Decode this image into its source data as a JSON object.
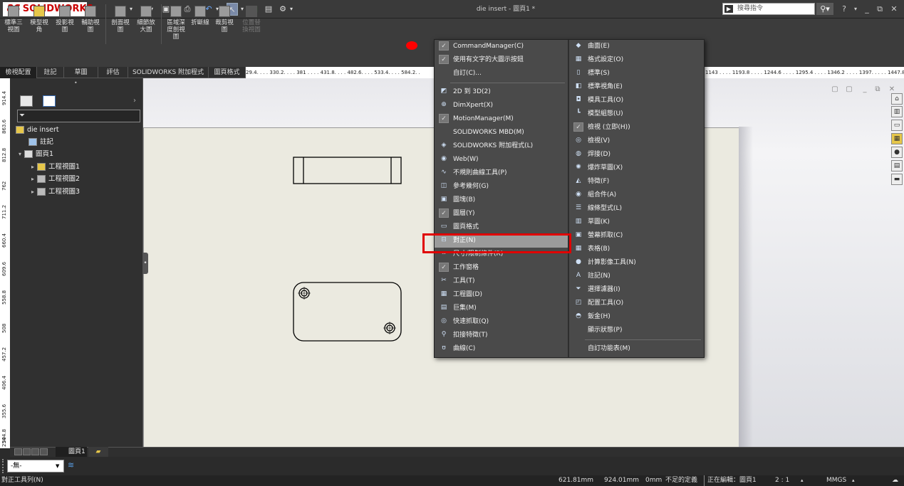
{
  "app": {
    "logo_text": "SOLIDWORKS",
    "document_title": "die insert - 圖頁1 *",
    "search_placeholder": "搜尋指令"
  },
  "ribbon": {
    "buttons": [
      {
        "label": "標準三\n視圖",
        "enabled": true
      },
      {
        "label": "模型視\n角",
        "enabled": true
      },
      {
        "label": "投影視\n圖",
        "enabled": true
      },
      {
        "label": "輔助視\n圖",
        "enabled": true
      },
      {
        "label": "剖面視\n圖",
        "enabled": true
      },
      {
        "label": "細節放\n大圖",
        "enabled": true
      },
      {
        "label": "區域深\n度剖視\n圖",
        "enabled": true
      },
      {
        "label": "折斷線",
        "enabled": true
      },
      {
        "label": "裁剪視\n圖",
        "enabled": true
      },
      {
        "label": "位置替\n換視圖",
        "enabled": false
      }
    ]
  },
  "tabs": [
    "檢視配置",
    "註記",
    "草圖",
    "評估",
    "SOLIDWORKS 附加程式",
    "圖頁格式"
  ],
  "rulers": {
    "horizontal_left": "29.4. . . . 330.2. . . . 381 . . . . 431.8. . . . 482.6. . . . 533.4. . . . 584.2. .",
    "horizontal_right": "1143 . . . . 1193.8 . . . . 1244.6 . . . . 1295.4 . . . . 1346.2 . . . . 1397. . . . . 1447.8 . . . . 14",
    "vertical": [
      "914.4",
      "863.6",
      "812.8",
      "762",
      "711.2",
      "660.4",
      "609.6",
      "558.8",
      "508",
      "457.2",
      "406.4",
      "355.6",
      "304.8",
      "254"
    ]
  },
  "feature_tree": {
    "items": [
      {
        "label": "die insert",
        "level": 0,
        "expander": ""
      },
      {
        "label": "註記",
        "level": 1,
        "expander": ""
      },
      {
        "label": "圖頁1",
        "level": 0,
        "expander": "▾"
      },
      {
        "label": "工程視圖1",
        "level": 2,
        "expander": "▸"
      },
      {
        "label": "工程視圖2",
        "level": 2,
        "expander": "▸"
      },
      {
        "label": "工程視圖3",
        "level": 2,
        "expander": "▸"
      }
    ]
  },
  "sheet_tab": "圖頁1",
  "combo": {
    "value": "-無-"
  },
  "status": {
    "left": "對正工具列(N)",
    "x": "621.81mm",
    "y": "924.01mm",
    "z": "0mm",
    "define_state": "不足的定義",
    "editing": "正在編輯：圖頁1",
    "scale": "2 : 1",
    "units": "MMGS"
  },
  "context_menu": {
    "left_column": [
      {
        "label": "CommandManager(C)",
        "icon": "check",
        "checked": true
      },
      {
        "label": "使用有文字的大圖示按鈕",
        "icon": "check",
        "checked": true
      },
      {
        "label": "自訂(C)...",
        "icon": "none",
        "checked": false
      },
      {
        "separator": true
      },
      {
        "label": "2D 到 3D(2)",
        "icon": "2d-to-3d-icon"
      },
      {
        "label": "DimXpert(X)",
        "icon": "dimxpert-icon"
      },
      {
        "label": "MotionManager(M)",
        "icon": "check",
        "checked": true
      },
      {
        "label": "SOLIDWORKS MBD(M)",
        "icon": "none"
      },
      {
        "label": "SOLIDWORKS 附加程式(L)",
        "icon": "addins-icon"
      },
      {
        "label": "Web(W)",
        "icon": "web-icon"
      },
      {
        "label": "不規則曲線工具(P)",
        "icon": "spline-icon"
      },
      {
        "label": "參考幾何(G)",
        "icon": "reference-geometry-icon"
      },
      {
        "label": "圖塊(B)",
        "icon": "blocks-icon"
      },
      {
        "label": "圖層(Y)",
        "icon": "check",
        "checked": true
      },
      {
        "label": "圖頁格式",
        "icon": "sheet-format-icon"
      },
      {
        "label": "對正(N)",
        "icon": "align-icon",
        "highlighted": true
      },
      {
        "label": "尺寸/限制條件(R)",
        "icon": "dimensions-icon"
      },
      {
        "label": "工作窗格",
        "icon": "check",
        "checked": true
      },
      {
        "label": "工具(T)",
        "icon": "tools-icon"
      },
      {
        "label": "工程圖(D)",
        "icon": "drawing-icon"
      },
      {
        "label": "巨集(M)",
        "icon": "macro-icon"
      },
      {
        "label": "快速抓取(Q)",
        "icon": "quick-snaps-icon"
      },
      {
        "label": "扣接特徵(T)",
        "icon": "fastening-icon"
      },
      {
        "label": "曲線(C)",
        "icon": "curves-icon"
      }
    ],
    "right_column": [
      {
        "label": "曲面(E)",
        "icon": "surfaces-icon"
      },
      {
        "label": "格式設定(O)",
        "icon": "formatting-icon"
      },
      {
        "label": "標準(S)",
        "icon": "standard-icon"
      },
      {
        "label": "標準視角(E)",
        "icon": "standard-views-icon"
      },
      {
        "label": "模具工具(O)",
        "icon": "mold-tools-icon"
      },
      {
        "label": "模型組態(U)",
        "icon": "configurations-icon"
      },
      {
        "label": "檢視 (立即(H))",
        "icon": "check",
        "checked": true
      },
      {
        "label": "檢視(V)",
        "icon": "view-icon"
      },
      {
        "label": "焊接(D)",
        "icon": "weldments-icon"
      },
      {
        "label": "爆炸草圖(X)",
        "icon": "explode-sketch-icon"
      },
      {
        "label": "特徵(F)",
        "icon": "features-icon"
      },
      {
        "label": "組合件(A)",
        "icon": "assembly-icon"
      },
      {
        "label": "線條型式(L)",
        "icon": "line-format-icon"
      },
      {
        "label": "草圖(K)",
        "icon": "sketch-icon"
      },
      {
        "label": "螢幕抓取(C)",
        "icon": "screen-capture-icon"
      },
      {
        "label": "表格(B)",
        "icon": "table-icon"
      },
      {
        "label": "計算影像工具(N)",
        "icon": "render-tools-icon"
      },
      {
        "label": "註記(N)",
        "icon": "annotation-icon"
      },
      {
        "label": "選擇濾器(I)",
        "icon": "selection-filter-icon"
      },
      {
        "label": "配置工具(O)",
        "icon": "layout-tools-icon"
      },
      {
        "label": "鈑金(H)",
        "icon": "sheet-metal-icon"
      },
      {
        "label": "顯示狀態(P)",
        "icon": "none"
      },
      {
        "separator": true
      },
      {
        "label": "自訂功能表(M)",
        "icon": "none"
      }
    ]
  },
  "colors": {
    "highlight_box": "#e00000",
    "red_marker": "#ff0000",
    "menu_bg": "#4a4a4a",
    "sheet_bg": "#ebeae0"
  }
}
